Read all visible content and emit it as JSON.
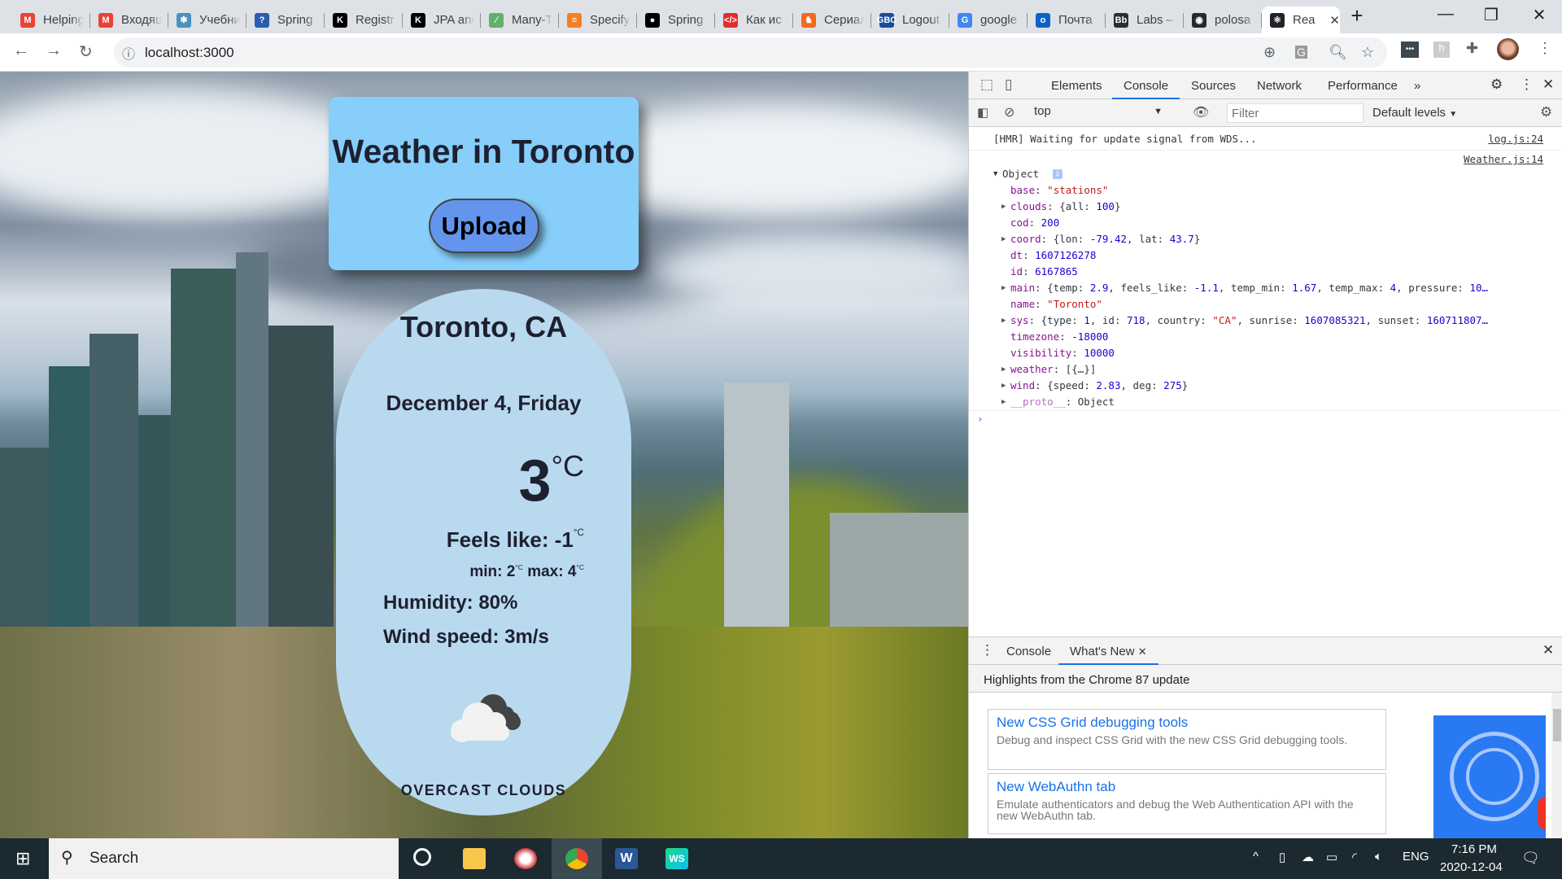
{
  "browser": {
    "tabs": [
      {
        "label": "Helping",
        "color": "#ea4335",
        "glyph": "M"
      },
      {
        "label": "Входящ",
        "color": "#ea4335",
        "glyph": "M"
      },
      {
        "label": "Учебни",
        "color": "#4a90c2",
        "glyph": "✱"
      },
      {
        "label": "Spring",
        "color": "#2a5cb0",
        "glyph": "?"
      },
      {
        "label": "Registr",
        "color": "#000000",
        "glyph": "K"
      },
      {
        "label": "JPA and",
        "color": "#000000",
        "glyph": "K"
      },
      {
        "label": "Many-T",
        "color": "#5fb16c",
        "glyph": "∕"
      },
      {
        "label": "Specify",
        "color": "#f48024",
        "glyph": "≡"
      },
      {
        "label": "Spring",
        "color": "#000000",
        "glyph": "●"
      },
      {
        "label": "Как ис",
        "color": "#e02d2d",
        "glyph": "</>"
      },
      {
        "label": "Сериал",
        "color": "#f26a1b",
        "glyph": "♞"
      },
      {
        "label": "Logout",
        "color": "#1a4c9c",
        "glyph": "GBC"
      },
      {
        "label": "google",
        "color": "#4285f4",
        "glyph": "G"
      },
      {
        "label": "Почта",
        "color": "#0a64c8",
        "glyph": "o"
      },
      {
        "label": "Labs –",
        "color": "#2d2d2d",
        "glyph": "Bb"
      },
      {
        "label": "polosa",
        "color": "#24292e",
        "glyph": "◉"
      },
      {
        "label": "Rea",
        "color": "#20232a",
        "glyph": "⚛"
      }
    ],
    "url": "localhost:3000"
  },
  "weather": {
    "title": "Weather in Toronto",
    "upload_label": "Upload",
    "city": "Toronto, CA",
    "date": "December 4, Friday",
    "temp": "3",
    "unit": "°C",
    "feels_like": "Feels like: -1",
    "min": "min: 2",
    "max": "max: 4",
    "humidity": "Humidity: 80%",
    "wind": "Wind speed: 3m/s",
    "description": "OVERCAST CLOUDS"
  },
  "devtools": {
    "tabs": [
      "Elements",
      "Console",
      "Sources",
      "Network",
      "Performance"
    ],
    "context": "top",
    "filter_placeholder": "Filter",
    "levels": "Default levels",
    "hmr": "[HMR] Waiting for update signal from WDS...",
    "hmr_src": "log.js:24",
    "obj_src": "Weather.js:14",
    "object_label": "Object",
    "lines": [
      [
        [
          "k",
          "base"
        ],
        [
          "g",
          ": "
        ],
        [
          "s",
          "\"stations\""
        ]
      ],
      [
        [
          "k",
          "clouds"
        ],
        [
          "g",
          ": {all: "
        ],
        [
          "n",
          "100"
        ],
        [
          "g",
          "}"
        ]
      ],
      [
        [
          "k",
          "cod"
        ],
        [
          "g",
          ": "
        ],
        [
          "n",
          "200"
        ]
      ],
      [
        [
          "k",
          "coord"
        ],
        [
          "g",
          ": {lon: "
        ],
        [
          "n",
          "-79.42"
        ],
        [
          "g",
          ", lat: "
        ],
        [
          "n",
          "43.7"
        ],
        [
          "g",
          "}"
        ]
      ],
      [
        [
          "k",
          "dt"
        ],
        [
          "g",
          ": "
        ],
        [
          "n",
          "1607126278"
        ]
      ],
      [
        [
          "k",
          "id"
        ],
        [
          "g",
          ": "
        ],
        [
          "n",
          "6167865"
        ]
      ],
      [
        [
          "k",
          "main"
        ],
        [
          "g",
          ": {temp: "
        ],
        [
          "n",
          "2.9"
        ],
        [
          "g",
          ", feels_like: "
        ],
        [
          "n",
          "-1.1"
        ],
        [
          "g",
          ", temp_min: "
        ],
        [
          "n",
          "1.67"
        ],
        [
          "g",
          ", temp_max: "
        ],
        [
          "n",
          "4"
        ],
        [
          "g",
          ", pressure: "
        ],
        [
          "n",
          "10…"
        ]
      ],
      [
        [
          "k",
          "name"
        ],
        [
          "g",
          ": "
        ],
        [
          "s",
          "\"Toronto\""
        ]
      ],
      [
        [
          "k",
          "sys"
        ],
        [
          "g",
          ": {type: "
        ],
        [
          "n",
          "1"
        ],
        [
          "g",
          ", id: "
        ],
        [
          "n",
          "718"
        ],
        [
          "g",
          ", country: "
        ],
        [
          "s",
          "\"CA\""
        ],
        [
          "g",
          ", sunrise: "
        ],
        [
          "n",
          "1607085321"
        ],
        [
          "g",
          ", sunset: "
        ],
        [
          "n",
          "160711807…"
        ]
      ],
      [
        [
          "k",
          "timezone"
        ],
        [
          "g",
          ": "
        ],
        [
          "n",
          "-18000"
        ]
      ],
      [
        [
          "k",
          "visibility"
        ],
        [
          "g",
          ": "
        ],
        [
          "n",
          "10000"
        ]
      ],
      [
        [
          "k",
          "weather"
        ],
        [
          "g",
          ": [{…}]"
        ]
      ],
      [
        [
          "k",
          "wind"
        ],
        [
          "g",
          ": {speed: "
        ],
        [
          "n",
          "2.83"
        ],
        [
          "g",
          ", deg: "
        ],
        [
          "n",
          "275"
        ],
        [
          "g",
          "}"
        ]
      ],
      [
        [
          "p",
          "__proto__"
        ],
        [
          "g",
          ": Object"
        ]
      ]
    ],
    "expandable": [
      false,
      true,
      false,
      true,
      false,
      false,
      true,
      false,
      true,
      false,
      false,
      true,
      true,
      true
    ],
    "drawer": {
      "tabs": [
        "Console",
        "What's New"
      ],
      "highlights": "Highlights from the Chrome 87 update",
      "cards": [
        {
          "title": "New CSS Grid debugging tools",
          "desc": "Debug and inspect CSS Grid with the new CSS Grid debugging tools."
        },
        {
          "title": "New WebAuthn tab",
          "desc": "Emulate authenticators and debug the Web Authentication API with the new WebAuthn tab."
        }
      ]
    }
  },
  "taskbar": {
    "search": "Search",
    "lang": "ENG",
    "time": "7:16 PM",
    "date": "2020-12-04"
  }
}
